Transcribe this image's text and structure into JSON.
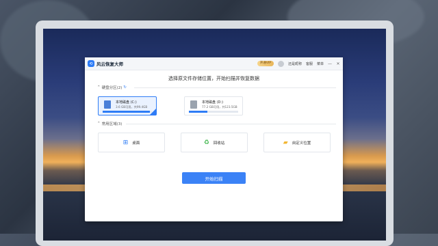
{
  "app": {
    "title": "风云恢复大师",
    "vip_label": "开通VIP",
    "user_label": "还是昵称",
    "help_label": "客服",
    "menu_label": "菜单",
    "minimize_symbol": "—",
    "close_symbol": "✕"
  },
  "main": {
    "subtitle": "选择原文件存储位置，开始扫描并恢复数据",
    "partition_section": "硬盘分区(2)",
    "common_section": "常用区域(3)",
    "drives": [
      {
        "name": "本地磁盘 (C:)",
        "size": "3.6 GB可用，共99.4GB",
        "used_fraction": 0.96,
        "selected": true
      },
      {
        "name": "本地磁盘 (D:)",
        "size": "77.2 GB可用，共123.5GB",
        "used_fraction": 0.38,
        "selected": false
      }
    ],
    "locations": [
      {
        "label": "桌面",
        "icon": "windows-desktop-icon"
      },
      {
        "label": "回收站",
        "icon": "recycle-bin-icon"
      },
      {
        "label": "自定义位置",
        "icon": "folder-icon"
      }
    ],
    "start_button": "开始扫描"
  },
  "colors": {
    "accent": "#2e7cf6",
    "button": "#3b82f6"
  }
}
